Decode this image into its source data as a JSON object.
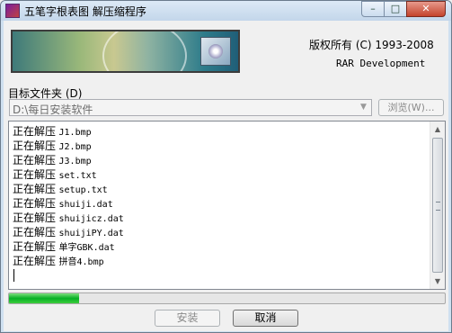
{
  "window": {
    "title": "五笔字根表图 解压缩程序",
    "controls": {
      "minimize": "–",
      "maximize": "□",
      "close": "✕"
    }
  },
  "header": {
    "copyright": "版权所有 (C) 1993-2008",
    "company": "RAR Development"
  },
  "target": {
    "label": "目标文件夹 (D)",
    "path": "D:\\每日安装软件",
    "browse_label": "浏览(W)..."
  },
  "log": {
    "lines": [
      {
        "verb": "正在解压",
        "file": "J1.bmp"
      },
      {
        "verb": "正在解压",
        "file": "J2.bmp"
      },
      {
        "verb": "正在解压",
        "file": "J3.bmp"
      },
      {
        "verb": "正在解压",
        "file": "set.txt"
      },
      {
        "verb": "正在解压",
        "file": "setup.txt"
      },
      {
        "verb": "正在解压",
        "file": "shuiji.dat"
      },
      {
        "verb": "正在解压",
        "file": "shuijicz.dat"
      },
      {
        "verb": "正在解压",
        "file": "shuijiPY.dat"
      },
      {
        "verb": "正在解压",
        "file": "单字GBK.dat"
      },
      {
        "verb": "正在解压",
        "file": "拼音4.bmp"
      }
    ]
  },
  "progress": {
    "percent": 16
  },
  "buttons": {
    "install": "安装",
    "cancel": "取消"
  },
  "colors": {
    "progress_fill": "#06b025",
    "close_button": "#c4432c"
  }
}
